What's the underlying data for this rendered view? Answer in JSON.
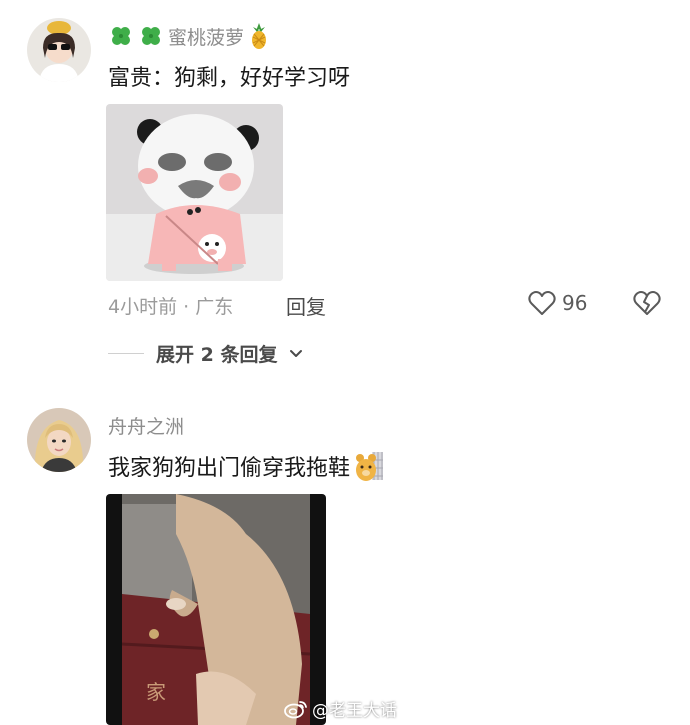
{
  "comments": [
    {
      "username": "蜜桃菠萝",
      "text": "富贵：狗剩，好好学习呀",
      "time_location": "4小时前 · 广东",
      "reply_label": "回复",
      "like_count": "96",
      "expand_label": "展开 2 条回复",
      "icons": [
        "clover-icon",
        "clover-icon",
        "pineapple-icon"
      ]
    },
    {
      "username": "舟舟之洲",
      "text": "我家狗狗出门偷穿我拖鞋",
      "icons": [
        "bear-emoji-icon"
      ]
    }
  ],
  "watermark": {
    "text": "@老王大话"
  },
  "colors": {
    "username": "#8d8d8d",
    "text": "#1a1a1a",
    "meta": "#9b9b9b",
    "action": "#4a4a4a"
  }
}
